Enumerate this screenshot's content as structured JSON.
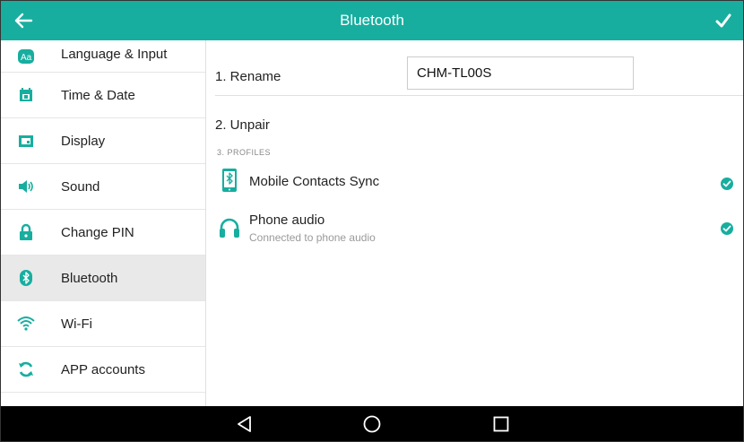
{
  "header": {
    "title": "Bluetooth",
    "back_icon": "arrow-left-icon",
    "confirm_icon": "checkmark-icon",
    "color": "#17ae9f"
  },
  "sidebar": {
    "items": [
      {
        "label": "Language & Input",
        "icon": "language-icon"
      },
      {
        "label": "Time & Date",
        "icon": "calendar-icon"
      },
      {
        "label": "Display",
        "icon": "display-icon"
      },
      {
        "label": "Sound",
        "icon": "speaker-icon"
      },
      {
        "label": "Change PIN",
        "icon": "lock-icon"
      },
      {
        "label": "Bluetooth",
        "icon": "bluetooth-icon",
        "selected": true
      },
      {
        "label": "Wi-Fi",
        "icon": "wifi-icon"
      },
      {
        "label": "APP accounts",
        "icon": "sync-icon"
      }
    ]
  },
  "main": {
    "rename": {
      "label": "1. Rename",
      "value": "CHM-TL00S"
    },
    "unpair": {
      "label": "2. Unpair"
    },
    "profiles_header": "3. PROFILES",
    "profiles": [
      {
        "title": "Mobile Contacts Sync",
        "subtitle": "",
        "icon": "phone-bluetooth-icon",
        "checked": true
      },
      {
        "title": "Phone audio",
        "subtitle": "Connected to phone audio",
        "icon": "headphones-icon",
        "checked": true
      }
    ]
  },
  "navbar": {
    "icons": [
      "back-triangle-icon",
      "home-circle-icon",
      "recent-square-icon"
    ]
  },
  "colors": {
    "accent": "#17ae9f",
    "selected_bg": "#e9e9e9"
  }
}
